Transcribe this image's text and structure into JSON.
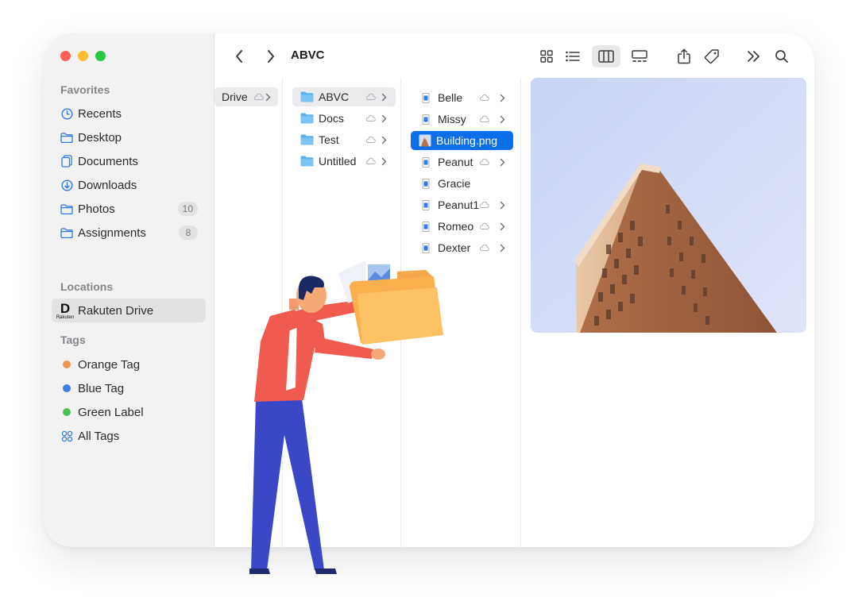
{
  "window": {
    "traffic_colors": [
      "#fe5f57",
      "#febc2e",
      "#28c840"
    ]
  },
  "sidebar": {
    "favorites_title": "Favorites",
    "favorites": [
      {
        "label": "Recents",
        "icon": "clock-icon"
      },
      {
        "label": "Desktop",
        "icon": "folder-icon"
      },
      {
        "label": "Documents",
        "icon": "document-icon"
      },
      {
        "label": "Downloads",
        "icon": "download-icon"
      },
      {
        "label": "Photos",
        "icon": "folder-icon",
        "badge": "10"
      },
      {
        "label": "Assignments",
        "icon": "folder-icon",
        "badge": "8"
      }
    ],
    "locations_title": "Locations",
    "locations": [
      {
        "label": "Rakuten Drive",
        "icon": "rakuten-drive-logo",
        "logo_letter": "D",
        "logo_text": "Rakuten"
      }
    ],
    "tags_title": "Tags",
    "tags": [
      {
        "label": "Orange Tag",
        "color": "#f0974f"
      },
      {
        "label": "Blue Tag",
        "color": "#3f7ee8"
      },
      {
        "label": "Green Label",
        "color": "#4cc35a"
      },
      {
        "label": "All Tags",
        "icon": "all-tags-icon"
      }
    ]
  },
  "toolbar": {
    "title": "ABVC",
    "icons": [
      "back-icon",
      "forward-icon",
      "grid-view-icon",
      "list-view-icon",
      "column-view-icon",
      "gallery-view-icon",
      "share-icon",
      "tag-icon",
      "more-icon",
      "search-icon"
    ]
  },
  "columns": {
    "col1": [
      {
        "label": "Drive"
      }
    ],
    "col2": [
      {
        "label": "ABVC"
      },
      {
        "label": "Docs"
      },
      {
        "label": "Test"
      },
      {
        "label": "Untitled"
      }
    ],
    "col3": [
      {
        "label": "Belle",
        "cloud": true,
        "chevron": true
      },
      {
        "label": "Missy",
        "cloud": true,
        "chevron": true
      },
      {
        "label": "Building.png",
        "cloud": false,
        "chevron": false
      },
      {
        "label": "Peanut",
        "cloud": true,
        "chevron": true
      },
      {
        "label": "Gracie",
        "cloud": false,
        "chevron": false
      },
      {
        "label": "Peanut1",
        "cloud": true,
        "chevron": true
      },
      {
        "label": "Romeo",
        "cloud": true,
        "chevron": true
      },
      {
        "label": "Dexter",
        "cloud": true,
        "chevron": true
      }
    ]
  },
  "accent_color": "#0a6fe8",
  "folder_color": "#5ab1ee"
}
